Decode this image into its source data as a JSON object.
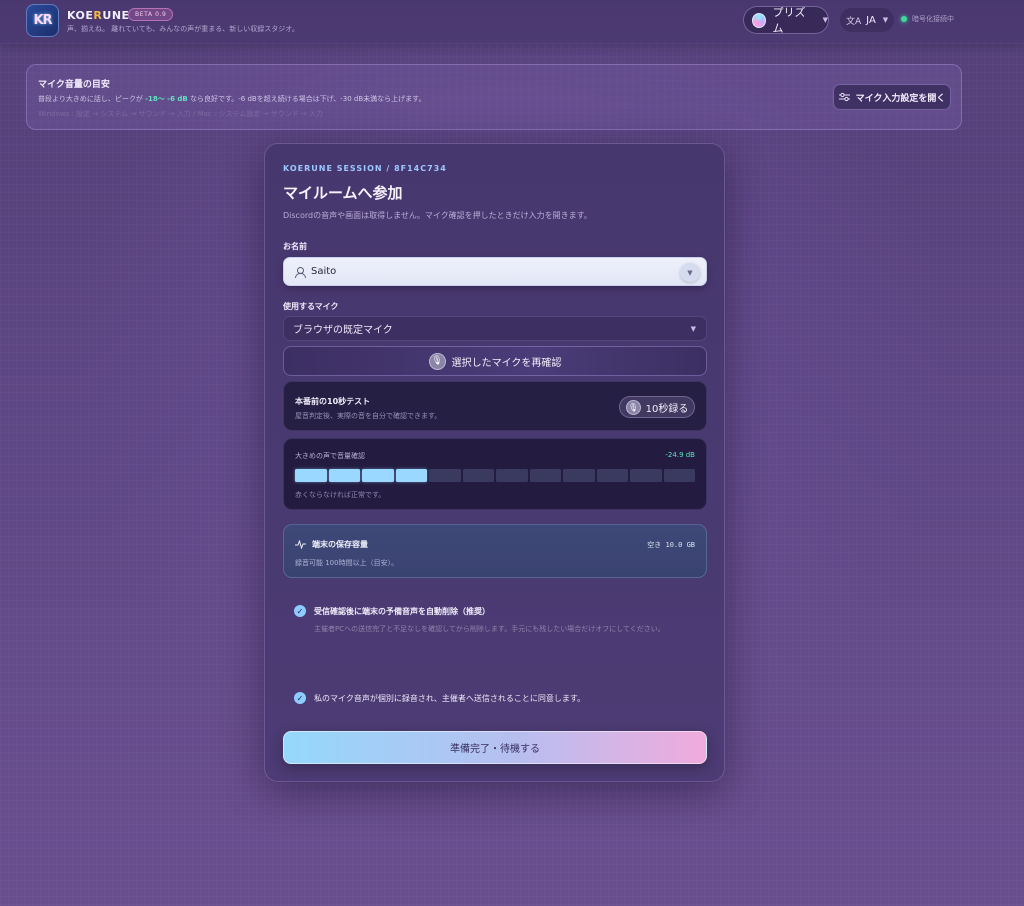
{
  "header": {
    "logo_text": "KR",
    "brand_prefix": "KOE",
    "brand_accent": "R",
    "brand_suffix": "UNE",
    "beta": "BETA 0.9",
    "tagline": "声、揃えね。 離れていても、みんなの声が重まる、新しい収録スタジオ。",
    "theme_label": "プリズム",
    "lang_icon": "文A",
    "lang_label": "JA",
    "connection_status": "暗号化接続中"
  },
  "guide": {
    "title": "マイク音量の目安",
    "text_before": "普段より大きめに話し、ピークが ",
    "text_highlight": "-18〜 -6 dB",
    "text_after": " なら良好です。-6 dBを超え続ける場合は下げ、-30 dB未満なら上げます。",
    "sub": "Windows : 設定 → システム → サウンド → 入力    /    Mac : システム設定 → サウンド → 入力",
    "button_label": "マイク入力設定を開く"
  },
  "card": {
    "session": "KOERUNE SESSION / 8F14C734",
    "title": "マイルームへ参加",
    "description": "Discordの音声や画面は取得しません。マイク確認を押したときだけ入力を開きます。",
    "name_label": "お名前",
    "name_value": "Saito",
    "mic_label": "使用するマイク",
    "mic_value": "ブラウザの既定マイク",
    "recheck_label": "選択したマイクを再確認",
    "test": {
      "title": "本番前の10秒テスト",
      "description": "屋音判定後、実際の音を自分で確認できます。",
      "button": "10秒録る"
    },
    "level": {
      "label": "大きめの声で音量確認",
      "db": "-24.9 dB",
      "footer": "赤くならなければ正常です。",
      "active_segments": 4,
      "total_segments": 12
    },
    "storage": {
      "title": "端末の保存容量",
      "free": "空き 10.0 GB",
      "description": "録音可能 100時間以上（目安）。"
    },
    "option1": {
      "title": "受信確認後に端末の予備音声を自動削除（推奨）",
      "description": "主催者PCへの送信完了と不足なしを確認してから削除します。手元にも残したい場合だけオフにしてください。"
    },
    "option2": {
      "text": "私のマイク音声が個別に録音され、主催者へ送信されることに同意します。"
    },
    "ready_button": "準備完了・待機する"
  },
  "colors": {
    "accent_teal": "#5fe3c0",
    "meter_on": "#9ad8ff",
    "session_blue": "#9dc8ff"
  }
}
